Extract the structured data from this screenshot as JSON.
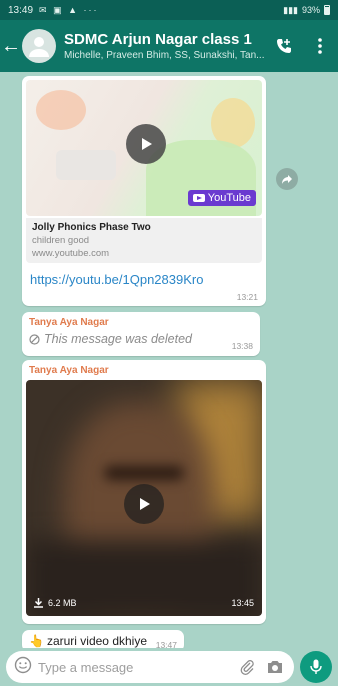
{
  "status_bar": {
    "time": "13:49",
    "right_text": "93%"
  },
  "header": {
    "title": "SDMC Arjun Nagar class 1",
    "subtitle": "Michelle, Praveen Bhim, SS, Sunakshi, Tan..."
  },
  "messages": {
    "link_preview": {
      "title": "Jolly Phonics Phase Two",
      "description": "children good",
      "domain": "www.youtube.com",
      "url": "https://youtu.be/1Qpn2839Kro",
      "time": "13:21",
      "badge_text": "YouTube"
    },
    "deleted": {
      "sender": "Tanya Aya Nagar",
      "text": "This message was deleted",
      "time": "13:38"
    },
    "video": {
      "sender": "Tanya Aya Nagar",
      "size": "6.2 MB",
      "time": "13:45"
    },
    "text": {
      "emoji": "👆",
      "body": "zaruri video dkhiye",
      "time": "13:47"
    }
  },
  "input": {
    "placeholder": "Type a message"
  },
  "colors": {
    "header": "#0e7566",
    "accent": "#0e9b7f",
    "sender": "#e07b4d",
    "link": "#2a86c7",
    "chat_bg": "#a9d3c7"
  }
}
